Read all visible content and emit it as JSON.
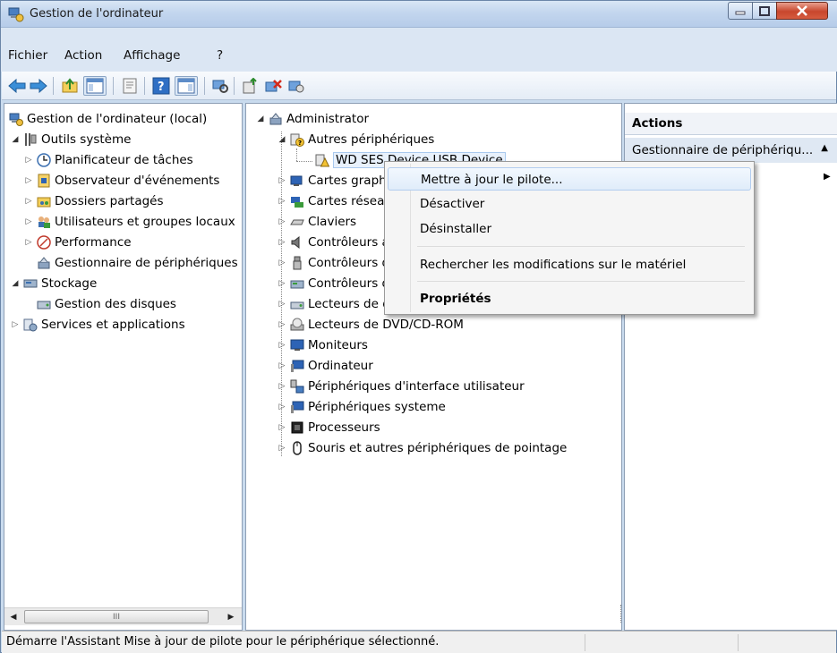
{
  "window": {
    "title": "Gestion de l'ordinateur",
    "controls": {
      "minimize": "–",
      "maximize": "□",
      "close": "✕"
    }
  },
  "menu": [
    "Fichier",
    "Action",
    "Affichage",
    "?"
  ],
  "toolbar": {
    "icons": [
      "back-arrow-icon",
      "forward-arrow-icon",
      "up-folder-icon",
      "show-hide-tree-icon",
      "properties-icon",
      "help-icon",
      "show-hide-actions-icon",
      "scan-hardware-icon",
      "update-driver-icon",
      "uninstall-icon",
      "disable-icon"
    ]
  },
  "left_tree": [
    {
      "label": "Gestion de l'ordinateur (local)",
      "icon": "computer-management-icon"
    },
    {
      "label": "Outils système",
      "icon": "system-tools-icon"
    },
    {
      "label": "Planificateur de tâches",
      "icon": "task-scheduler-icon"
    },
    {
      "label": "Observateur d'événements",
      "icon": "event-viewer-icon"
    },
    {
      "label": "Dossiers partagés",
      "icon": "shared-folders-icon"
    },
    {
      "label": "Utilisateurs et groupes locaux",
      "icon": "users-groups-icon"
    },
    {
      "label": "Performance",
      "icon": "performance-icon"
    },
    {
      "label": "Gestionnaire de périphériques",
      "icon": "device-manager-icon"
    },
    {
      "label": "Stockage",
      "icon": "storage-icon"
    },
    {
      "label": "Gestion des disques",
      "icon": "disk-management-icon"
    },
    {
      "label": "Services et applications",
      "icon": "services-apps-icon"
    }
  ],
  "device_tree": {
    "root": "Administrator",
    "other_devices": "Autres périphériques",
    "selected_device": "WD SES Device USB Device",
    "categories": [
      "Cartes graphiques",
      "Cartes réseau",
      "Claviers",
      "Contrôleurs audio, vidéo et jeu",
      "Contrôleurs de bus USB",
      "Contrôleurs de stockage",
      "Lecteurs de disque",
      "Lecteurs de DVD/CD-ROM",
      "Moniteurs",
      "Ordinateur",
      "Périphériques d'interface utilisateur",
      "Périphériques systeme",
      "Processeurs",
      "Souris et autres périphériques de pointage"
    ]
  },
  "actions": {
    "header": "Actions",
    "section": "Gestionnaire de périphériqu...",
    "up_glyph": "▲",
    "more_glyph": "▶"
  },
  "context_menu": {
    "items": [
      "Mettre à jour le pilote...",
      "Désactiver",
      "Désinstaller",
      "Rechercher les modifications sur le matériel",
      "Propriétés"
    ]
  },
  "scrollbar": {
    "thumb_grip": "III",
    "left": "◀",
    "right": "▶"
  },
  "status": "Démarre l'Assistant Mise à jour de pilote pour le périphérique sélectionné."
}
